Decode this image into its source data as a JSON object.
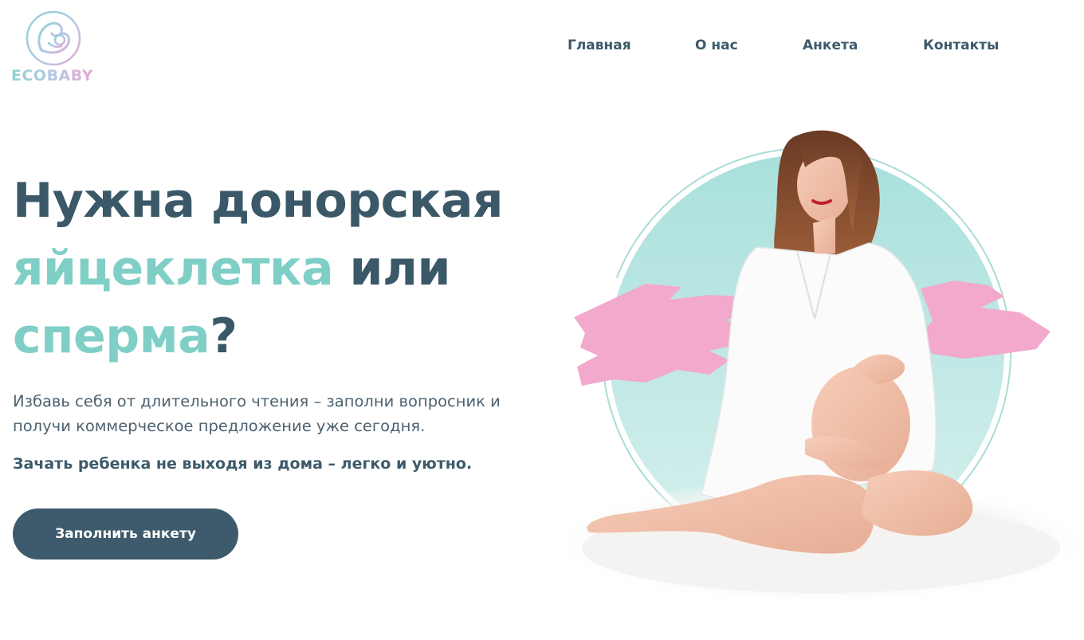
{
  "header": {
    "logo_text": "ECOBABY",
    "nav": [
      {
        "label": "Главная"
      },
      {
        "label": "О нас"
      },
      {
        "label": "Анкета"
      },
      {
        "label": "Контакты"
      }
    ]
  },
  "hero": {
    "title_line1": "Нужна донорская",
    "title_accent1": "яйцеклетка",
    "title_mid": " или",
    "title_accent2": "сперма",
    "title_end": "?",
    "subtitle": "Избавь себя от длительного чтения – заполни вопросник и получи коммерческое предложение уже сегодня.",
    "subtitle2": "Зачать ребенка не выходя из дома – легко и уютно.",
    "cta_label": "Заполнить анкету"
  },
  "colors": {
    "primary": "#3d5b6c",
    "accent_teal": "#7fcfc7",
    "accent_pink": "#f3a9cc",
    "circle": "#bde6e3"
  },
  "icons": {
    "logo_mark": "mother-and-baby-icon",
    "illustration": "pregnant-woman-photo"
  }
}
